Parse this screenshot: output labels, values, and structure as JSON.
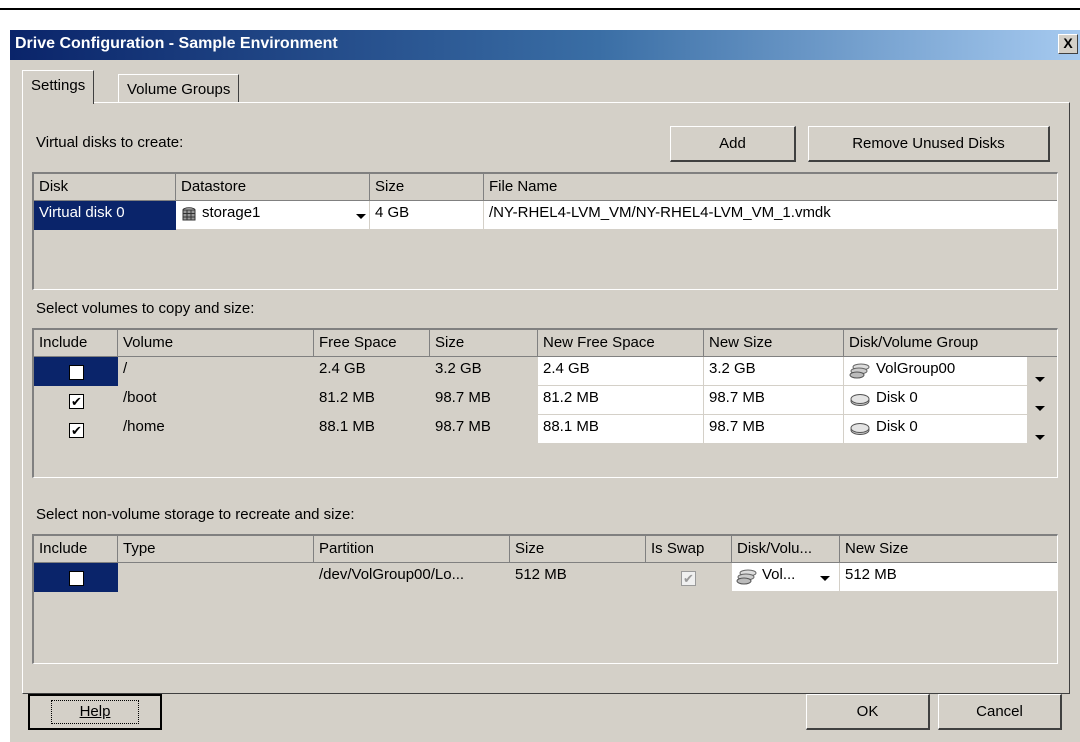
{
  "dialog": {
    "title": "Drive Configuration - Sample Environment",
    "close_label": "X"
  },
  "tabs": [
    {
      "label": "Settings",
      "active": true
    },
    {
      "label": "Volume Groups",
      "active": false
    }
  ],
  "disks": {
    "section_label": "Virtual disks to create:",
    "add_label": "Add",
    "remove_label": "Remove Unused Disks",
    "headers": [
      "Disk",
      "Datastore",
      "Size",
      "File Name"
    ],
    "rows": [
      {
        "disk": "Virtual disk 0",
        "datastore": "storage1",
        "size": "4 GB",
        "file_name": "/NY-RHEL4-LVM_VM/NY-RHEL4-LVM_VM_1.vmdk"
      }
    ]
  },
  "volumes": {
    "section_label": "Select volumes to copy and size:",
    "headers": [
      "Include",
      "Volume",
      "Free Space",
      "Size",
      "New Free Space",
      "New Size",
      "Disk/Volume Group"
    ],
    "rows": [
      {
        "include": true,
        "volume": "/",
        "free_space": "2.4 GB",
        "size": "3.2 GB",
        "new_free_space": "2.4 GB",
        "new_size": "3.2 GB",
        "disk_group": "VolGroup00",
        "disk_icon": "volume-group-icon"
      },
      {
        "include": true,
        "volume": "/boot",
        "free_space": "81.2 MB",
        "size": "98.7 MB",
        "new_free_space": "81.2 MB",
        "new_size": "98.7 MB",
        "disk_group": "Disk 0",
        "disk_icon": "disk-icon"
      },
      {
        "include": true,
        "volume": "/home",
        "free_space": "88.1 MB",
        "size": "98.7 MB",
        "new_free_space": "88.1 MB",
        "new_size": "98.7 MB",
        "disk_group": "Disk 0",
        "disk_icon": "disk-icon"
      }
    ]
  },
  "nonvolume": {
    "section_label": "Select non-volume storage to recreate and size:",
    "headers": [
      "Include",
      "Type",
      "Partition",
      "Size",
      "Is Swap",
      "Disk/Volu...",
      "New Size"
    ],
    "rows": [
      {
        "include": true,
        "type": "",
        "partition": "/dev/VolGroup00/Lo...",
        "size": "512 MB",
        "is_swap": true,
        "disk_group": "Vol...",
        "new_size": "512 MB"
      }
    ]
  },
  "footer": {
    "help_label": "Help",
    "ok_label": "OK",
    "cancel_label": "Cancel"
  },
  "colors": {
    "face": "#d4d0c8",
    "title_gradient_start": "#0a246a",
    "title_gradient_end": "#a6caf0",
    "selection": "#0a246a"
  }
}
